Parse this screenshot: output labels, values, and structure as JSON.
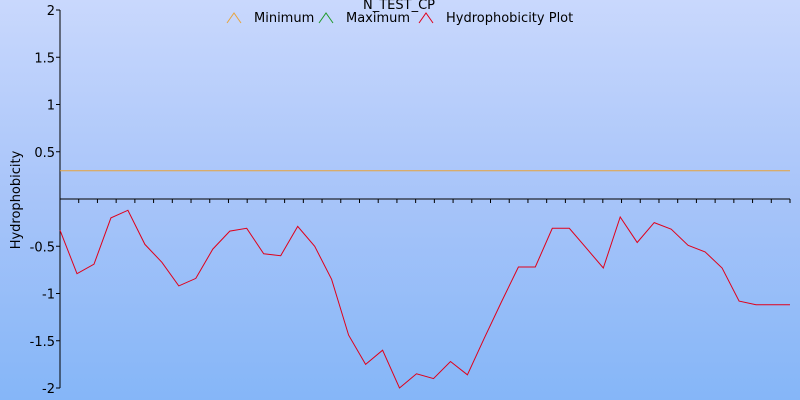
{
  "chart_data": {
    "type": "line",
    "title": "N_TEST_CP",
    "xlabel": "",
    "ylabel": "Hydrophobicity",
    "ylim": [
      -2,
      2
    ],
    "yticks": [
      {
        "value": 2,
        "label": "2"
      },
      {
        "value": 1.5,
        "label": "1.5"
      },
      {
        "value": 1,
        "label": "1"
      },
      {
        "value": 0.5,
        "label": "0.5"
      },
      {
        "value": -0.5,
        "label": "-0.5"
      },
      {
        "value": -1,
        "label": "-1"
      },
      {
        "value": -1.5,
        "label": "-1.5"
      },
      {
        "value": -2,
        "label": "-2"
      }
    ],
    "xlim": [
      1,
      44
    ],
    "x_tick_count": 40,
    "legend_position": "top-center",
    "series": [
      {
        "name": "Minimum",
        "color": "#e8a33c",
        "x": [
          1,
          44
        ],
        "values": [
          0.3,
          0.3
        ]
      },
      {
        "name": "Maximum",
        "color": "#1f9a2a",
        "x": [],
        "values": []
      },
      {
        "name": "Hydrophobicity Plot",
        "color": "#e0001a",
        "x": [
          1,
          2,
          3,
          4,
          5,
          6,
          7,
          8,
          9,
          10,
          11,
          12,
          13,
          14,
          15,
          16,
          17,
          18,
          19,
          20,
          21,
          22,
          23,
          24,
          25,
          26,
          27,
          28,
          29,
          30,
          31,
          32,
          33,
          34,
          35,
          36,
          37,
          38,
          39,
          40,
          41,
          42,
          43,
          44
        ],
        "values": [
          -0.33,
          -0.79,
          -0.69,
          -0.2,
          -0.12,
          -0.48,
          -0.67,
          -0.92,
          -0.84,
          -0.53,
          -0.34,
          -0.31,
          -0.58,
          -0.6,
          -0.29,
          -0.5,
          -0.85,
          -1.44,
          -1.75,
          -1.6,
          -2.0,
          -1.85,
          -1.9,
          -1.72,
          -1.86,
          -1.47,
          -1.09,
          -0.72,
          -0.72,
          -0.31,
          -0.31,
          -0.52,
          -0.73,
          -0.19,
          -0.46,
          -0.25,
          -0.32,
          -0.49,
          -0.56,
          -0.73,
          -1.08,
          -1.12,
          -1.12,
          -1.12
        ]
      }
    ]
  }
}
